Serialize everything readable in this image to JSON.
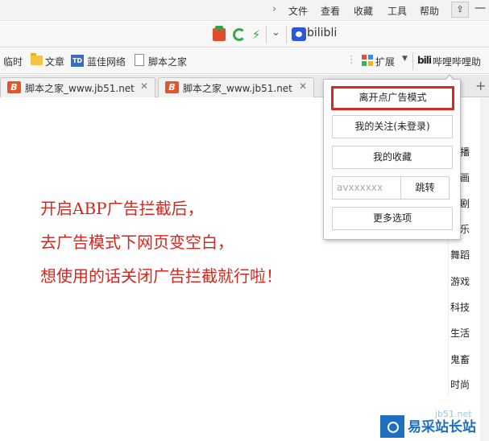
{
  "menubar": {
    "items": [
      "文件",
      "查看",
      "收藏",
      "工具",
      "帮助"
    ],
    "pin_icon": "⇪",
    "minimize": "—"
  },
  "addressbar": {
    "search_engine": "bilibli"
  },
  "bookmarks": {
    "items": [
      "临时",
      "文章",
      "蓝佳网络",
      "脚本之家"
    ],
    "td_label": "TD",
    "extensions_label": "扩展",
    "bili_label": "哔哩哔哩助",
    "bili_icon_text": "bili"
  },
  "tabs": [
    {
      "title": "脚本之家_www.jb51.net",
      "icon_text": "B"
    },
    {
      "title": "脚本之家_www.jb51.net",
      "icon_text": "B"
    }
  ],
  "popup": {
    "leave_ad_mode": "离开点广告模式",
    "my_following": "我的关注(未登录)",
    "my_favorites": "我的收藏",
    "av_placeholder": "avxxxxxx",
    "jump": "跳转",
    "more_options": "更多选项"
  },
  "annotation": {
    "lines": [
      "开启ABP广告拦截后，",
      "去广告模式下网页变空白，",
      "想使用的话关闭广告拦截就行啦！"
    ],
    "color": "#d6261d"
  },
  "category_nav": [
    "播",
    "画",
    "剧",
    "乐",
    "舞蹈",
    "游戏",
    "科技",
    "生活",
    "鬼畜",
    "时尚"
  ],
  "watermark": {
    "brand": "易采站长站",
    "url": "jb51.net"
  },
  "colors": {
    "highlight_border": "#d42a23",
    "brand_blue": "#1f6fbf"
  }
}
